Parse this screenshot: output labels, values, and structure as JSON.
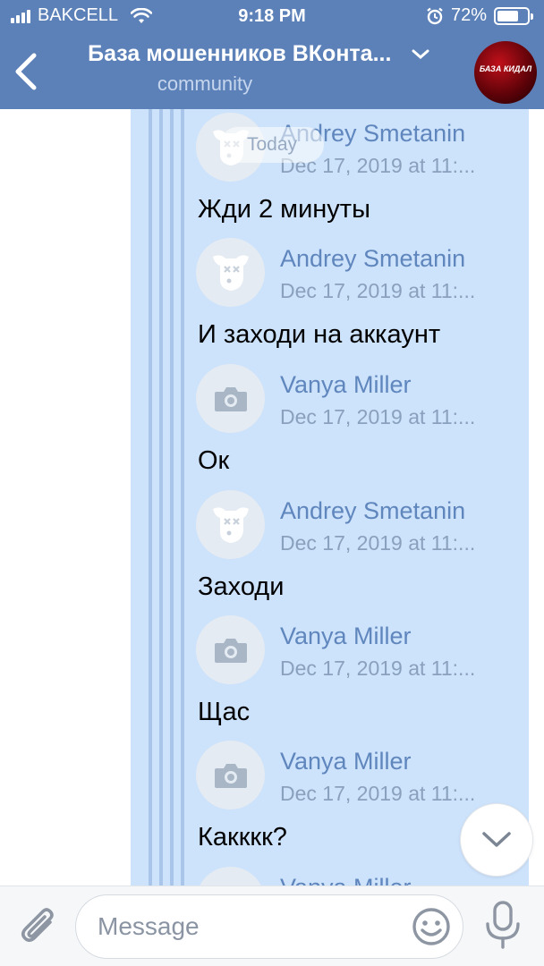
{
  "status_bar": {
    "carrier": "BAKCELL",
    "time": "9:18 PM",
    "battery": "72%",
    "battery_level": 0.72
  },
  "header": {
    "title": "База мошенников ВКонта...",
    "subtitle": "community",
    "avatar_text": "БАЗА КИДАЛ",
    "back_icon": "chevron-left-icon",
    "dropdown_icon": "chevron-down-icon"
  },
  "chat": {
    "date_pill": "Today",
    "messages": [
      {
        "author": "Andrey Smetanin",
        "date": "Dec 17, 2019 at 11:...",
        "text": "Жди 2 минуты",
        "avatar": "deactivated-dog-icon"
      },
      {
        "author": "Andrey Smetanin",
        "date": "Dec 17, 2019 at 11:...",
        "text": "И заходи на аккаунт",
        "avatar": "deactivated-dog-icon"
      },
      {
        "author": "Vanya Miller",
        "date": "Dec 17, 2019 at 11:...",
        "text": "Ок",
        "avatar": "camera-icon"
      },
      {
        "author": "Andrey Smetanin",
        "date": "Dec 17, 2019 at 11:...",
        "text": "Заходи",
        "avatar": "deactivated-dog-icon"
      },
      {
        "author": "Vanya Miller",
        "date": "Dec 17, 2019 at 11:...",
        "text": "Щас",
        "avatar": "camera-icon"
      },
      {
        "author": "Vanya Miller",
        "date": "Dec 17, 2019 at 11:...",
        "text": "Какккк?",
        "avatar": "camera-icon"
      },
      {
        "author": "Vanya Miller",
        "date": "",
        "text": "",
        "avatar": "camera-icon"
      }
    ]
  },
  "composer": {
    "placeholder": "Message",
    "attach_icon": "paperclip-icon",
    "emoji_icon": "smiley-icon",
    "mic_icon": "microphone-icon"
  },
  "colors": {
    "header_bg": "#5c81b8",
    "selection_bg": "#cde2fb",
    "author_name": "#5f86bd",
    "date_text": "#8aa1bd"
  }
}
